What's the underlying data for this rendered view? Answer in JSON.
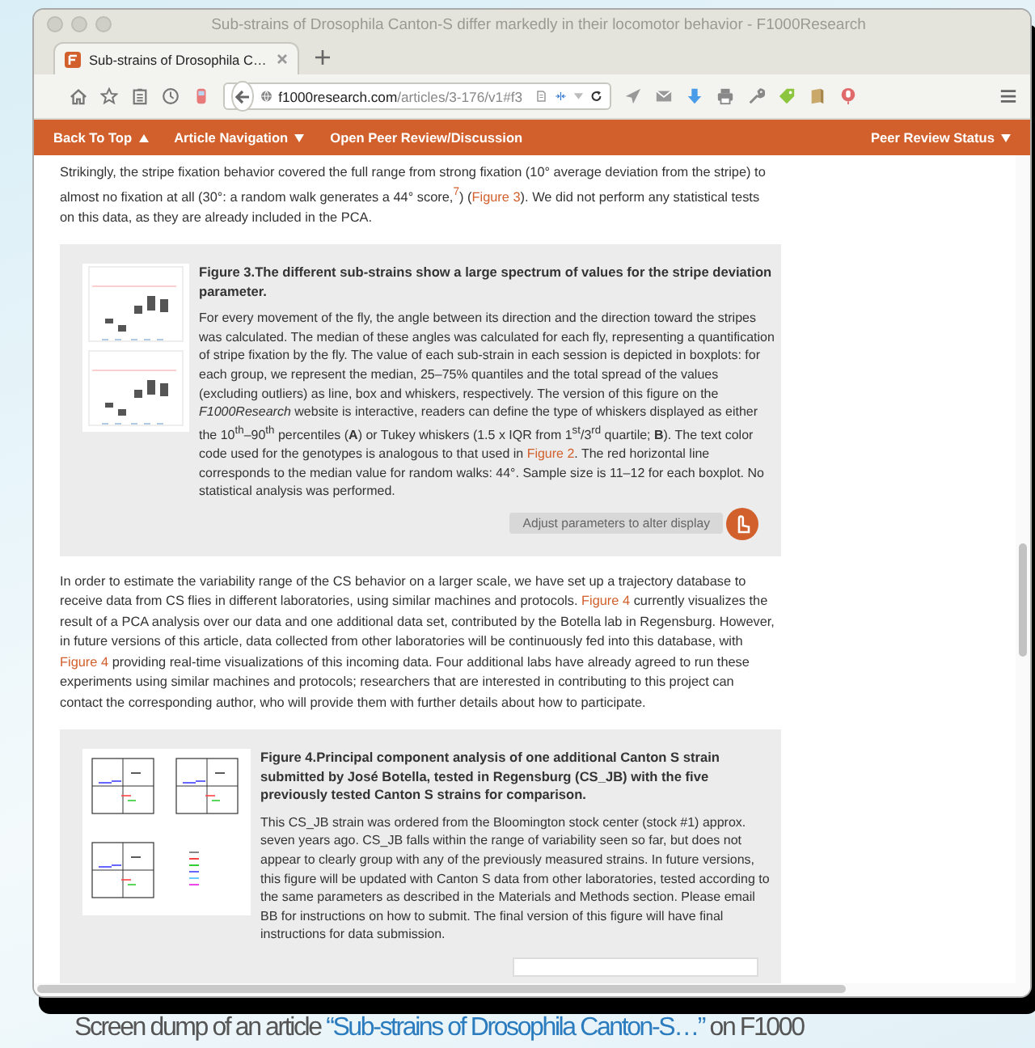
{
  "window": {
    "title": "Sub-strains of Drosophila Canton-S differ markedly in their locomotor behavior - F1000Research"
  },
  "tabs": [
    {
      "label": "Sub-strains of Drosophila C…",
      "selected": true
    }
  ],
  "toolbar": {
    "url_host": "f1000research.com",
    "url_path": "/articles/3-176/v1#f3"
  },
  "nav": {
    "left": [
      {
        "label": "Back To Top",
        "kind": "up"
      },
      {
        "label": "Article Navigation",
        "kind": "down"
      },
      {
        "label": "Open Peer Review/Discussion",
        "kind": "plain"
      }
    ],
    "right": [
      {
        "label": "Peer Review Status",
        "kind": "down"
      }
    ]
  },
  "article": {
    "blocks": [
      {
        "kind": "paragraph",
        "parts": [
          {
            "kind": "text",
            "text": "Strikingly, the stripe fixation behavior covered the full range from strong fixation (10° average deviation from the stripe) to almost no fixation at all (30°: a random walk generates a 44° score,"
          },
          {
            "kind": "link",
            "text": "$^{7}$"
          },
          {
            "kind": "text",
            "text": ") ("
          },
          {
            "kind": "link",
            "text": "Figure 3"
          },
          {
            "kind": "text",
            "text": "). We did not perform any statistical tests on this data, as they are already included in the PCA."
          }
        ]
      },
      {
        "kind": "boxplots",
        "title": "Figure 3.The different sub-strains show a large spectrum of values for the stripe deviation parameter.",
        "parts": [
          {
            "kind": "text",
            "text": "For every movement of the fly, the angle between its direction and the direction toward the stripes was calculated. The median of these angles was calculated for each fly, representing a quantification of stripe fixation by the fly. The value of each sub-strain in each session is depicted in boxplots: for each group, we represent the median, 25–75% quantiles and the total spread of the values (excluding outliers) as line, box and whiskers, respectively. The version of this figure on the *F1000Research* website is interactive, readers can define the type of whiskers displayed as either the 10$^{th}$–90$^{th}$ percentiles (**A**) or Tukey whiskers (1.5 x IQR from 1$^{st}$/3$^{rd}$ quartile; **B**). The text color code used for the genotypes is analogous to that used in "
          },
          {
            "kind": "link",
            "text": "Figure 2"
          },
          {
            "kind": "text",
            "text": ". The red horizontal line corresponds to the median value for random walks: 44°. Sample size is 11–12 for each boxplot. No statistical analysis was performed."
          }
        ],
        "footer": {
          "kind": "button",
          "label": "Adjust parameters to alter display"
        }
      },
      {
        "kind": "paragraph",
        "parts": [
          {
            "kind": "text",
            "text": "In order to estimate the variability range of the CS behavior on a larger scale, we have set up a trajectory database to receive data from CS flies in different laboratories, using similar machines and protocols. "
          },
          {
            "kind": "link",
            "text": "Figure 4"
          },
          {
            "kind": "text",
            "text": " currently visualizes the result of a PCA analysis over our data and one additional data set, contributed by the Botella lab in Regensburg. However, in future versions of this article, data collected from other laboratories will be continuously fed into this database, with "
          },
          {
            "kind": "link",
            "text": "Figure 4"
          },
          {
            "kind": "text",
            "text": " providing real-time visualizations of this incoming data. Four additional labs have already agreed to run these experiments using similar machines and protocols; researchers that are interested in contributing to this project can contact the corresponding author, who will provide them with further details about how to participate."
          }
        ]
      },
      {
        "kind": "pca",
        "title": "Figure 4.Principal component analysis of one additional Canton S strain submitted by José Botella, tested in Regensburg (CS_JB) with the five previously tested Canton S strains for comparison.",
        "parts": [
          {
            "kind": "text",
            "text": "This CS_JB strain was ordered from the Bloomington stock center (stock #1) approx. seven years ago. CS_JB falls within the range of variability seen so far, but does not appear to clearly group with any of the previously measured strains. In future versions, this figure will be updated with Canton S data from other laboratories, tested according to the same parameters as described in the Materials and Methods section. Please email BB for instructions on how to submit. The final version of this figure will have final instructions for data submission."
          }
        ],
        "footer": {
          "kind": "blank"
        }
      }
    ]
  },
  "caption": {
    "parts": [
      {
        "kind": "text",
        "text": "Screen dump of an article "
      },
      {
        "kind": "link",
        "text": "“Sub-strains of Drosophila Canton-S…”"
      },
      {
        "kind": "text",
        "text": " on F1000"
      }
    ]
  }
}
